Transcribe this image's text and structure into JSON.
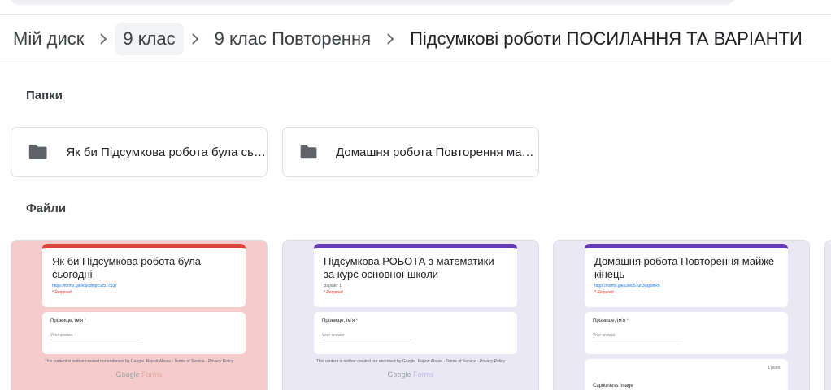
{
  "breadcrumb": {
    "items": [
      {
        "label": "Мій диск"
      },
      {
        "label": "9 клас"
      },
      {
        "label": "9 клас Повторення"
      },
      {
        "label": "Підсумкові роботи ПОСИЛАННЯ ТА ВАРІАНТИ"
      }
    ]
  },
  "sections": {
    "folders_title": "Папки",
    "files_title": "Файли"
  },
  "folders": [
    {
      "name": "Як би Підсумкова робота була сьогодні",
      "icon": "folder-icon"
    },
    {
      "name": "Домашня робота Повторення майже кінець",
      "icon": "folder-icon"
    }
  ],
  "files": [
    {
      "title": "Як би Підсумкова робота була сьогодні",
      "link": "https://forms.gle/k5jcdmpcSzz7c837",
      "required": "* Required",
      "question": "Прізвище, Ім'я *",
      "answer_placeholder": "Your answer",
      "footer": "This content is neither created nor endorsed by Google. Report Abuse - Terms of Service - Privacy Policy",
      "brand_google": "Google",
      "brand_forms": "Forms",
      "accent": "#db4437",
      "background": "#f5cccb"
    },
    {
      "title": "Підсумкова РОБОТА з математики за курс основної школи",
      "variant": "Варіант 1",
      "required": "* Required",
      "question": "Прізвище, Ім'я *",
      "answer_placeholder": "Your answer",
      "footer": "This content is neither created nor endorsed by Google. Report Abuse - Terms of Service - Privacy Policy",
      "brand_google": "Google",
      "brand_forms": "Forms",
      "accent": "#673ab7",
      "background": "#ebe8f6"
    },
    {
      "title": "Домашня робота Повторення майже кінець",
      "link": "https://forms.gle/i3Mu57uh3wgwifRh",
      "required": "* Required",
      "question": "Прізвище, Ім'я *",
      "answer_placeholder": "Your answer",
      "points": "1 point",
      "image_alt": "Captionless Image",
      "accent": "#673ab7",
      "background": "#ebe8f6"
    }
  ]
}
